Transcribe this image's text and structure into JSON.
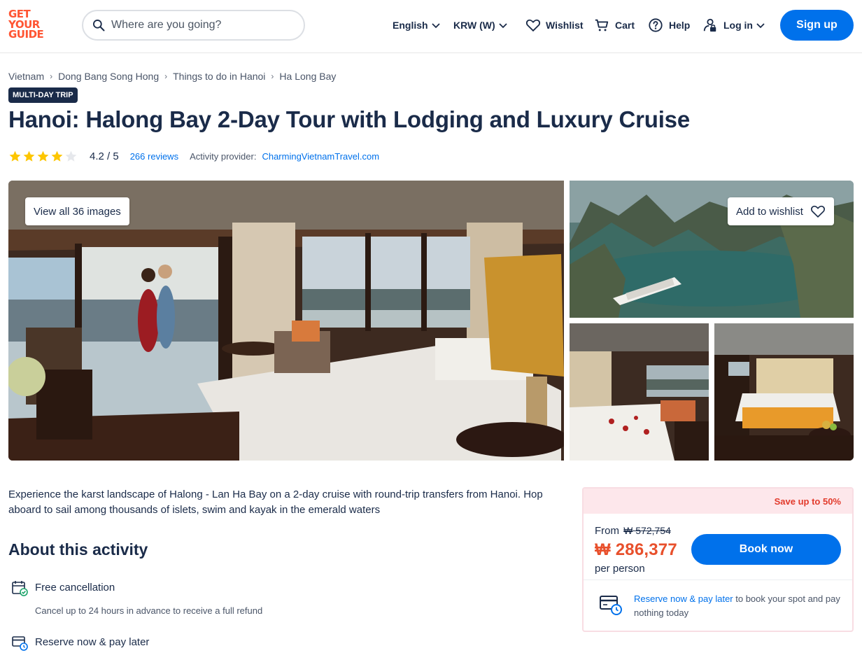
{
  "header": {
    "logo_lines": [
      "GET",
      "YOUR",
      "GUIDE"
    ],
    "search_placeholder": "Where are you going?",
    "language": "English",
    "currency": "KRW (W)",
    "wishlist": "Wishlist",
    "cart": "Cart",
    "help": "Help",
    "login": "Log in",
    "signup": "Sign up"
  },
  "breadcrumb": [
    "Vietnam",
    "Dong Bang Song Hong",
    "Things to do in Hanoi",
    "Ha Long Bay"
  ],
  "badge": "MULTI-DAY TRIP",
  "title": "Hanoi: Halong Bay 2-Day Tour with Lodging and Luxury Cruise",
  "rating": {
    "value": "4.2 / 5",
    "stars_filled": 4,
    "stars_total": 5,
    "reviews": "266 reviews",
    "provider_label": "Activity provider:",
    "provider": "CharmingVietnamTravel.com"
  },
  "gallery": {
    "view_all": "View all 36 images",
    "add_wishlist": "Add to wishlist"
  },
  "summary": "Experience the karst landscape of Halong - Lan Ha Bay on a 2-day cruise with round-trip transfers from Hanoi. Hop aboard to sail among thousands of islets, swim and kayak in the emerald waters",
  "about": {
    "title": "About this activity",
    "features": [
      {
        "title": "Free cancellation",
        "desc": "Cancel up to 24 hours in advance to receive a full refund"
      },
      {
        "title": "Reserve now & pay later",
        "desc": ""
      }
    ]
  },
  "booking": {
    "save": "Save up to 50%",
    "from": "From",
    "old_price": "₩ 572,754",
    "price": "₩ 286,377",
    "per_person": "per person",
    "book_now": "Book now",
    "reserve_link": "Reserve now & pay later",
    "reserve_text": " to book your spot and pay nothing today"
  },
  "colors": {
    "brand": "#ff5533",
    "primary": "#0071eb",
    "navy": "#1a2b49",
    "star": "#fdc600",
    "price": "#e8502c"
  }
}
